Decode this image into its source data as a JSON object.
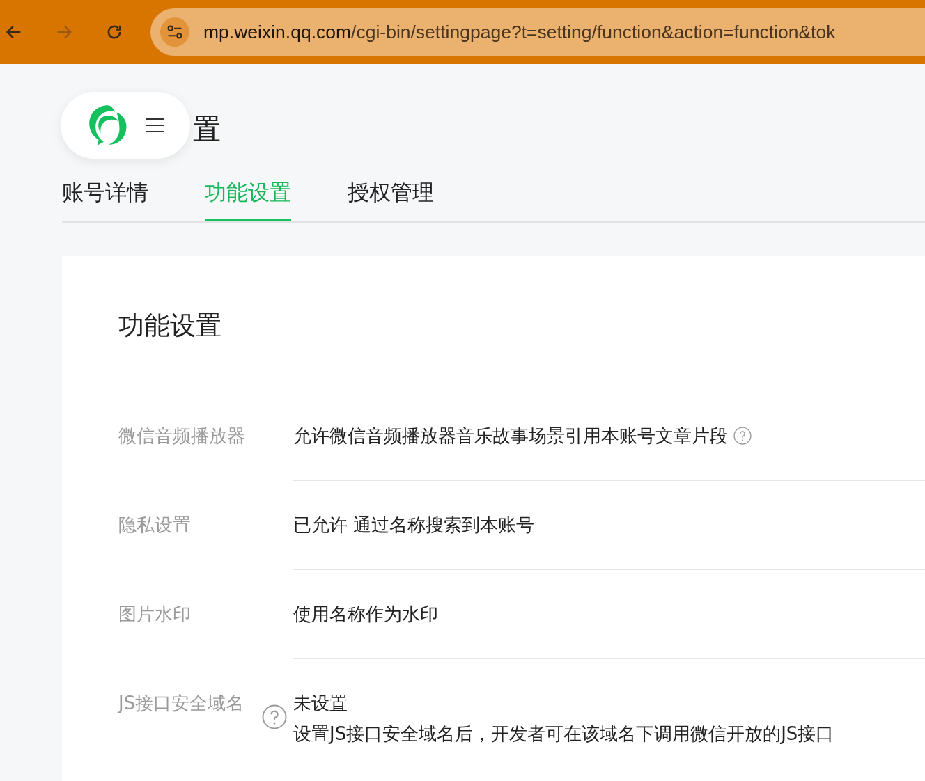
{
  "browser": {
    "url_host": "mp.weixin.qq.com",
    "url_path": "/cgi-bin/settingpage?t=setting/function&action=function&tok",
    "forward_disabled": true
  },
  "page_title": "置",
  "tabs": [
    {
      "label": "账号详情",
      "selected": false
    },
    {
      "label": "功能设置",
      "selected": true
    },
    {
      "label": "授权管理",
      "selected": false
    }
  ],
  "card": {
    "title": "功能设置",
    "rows": [
      {
        "label": "微信音频播放器",
        "label_help": false,
        "lines": [
          "允许微信音频播放器音乐故事场景引用本账号文章片段"
        ],
        "value_help": true
      },
      {
        "label": "隐私设置",
        "label_help": false,
        "lines": [
          "已允许 通过名称搜索到本账号"
        ],
        "value_help": false
      },
      {
        "label": "图片水印",
        "label_help": false,
        "lines": [
          "使用名称作为水印"
        ],
        "value_help": false
      },
      {
        "label": "JS接口安全域名",
        "label_help": true,
        "lines": [
          "未设置",
          "设置JS接口安全域名后，开发者可在该域名下调用微信开放的JS接口"
        ],
        "value_help": false
      }
    ]
  }
}
